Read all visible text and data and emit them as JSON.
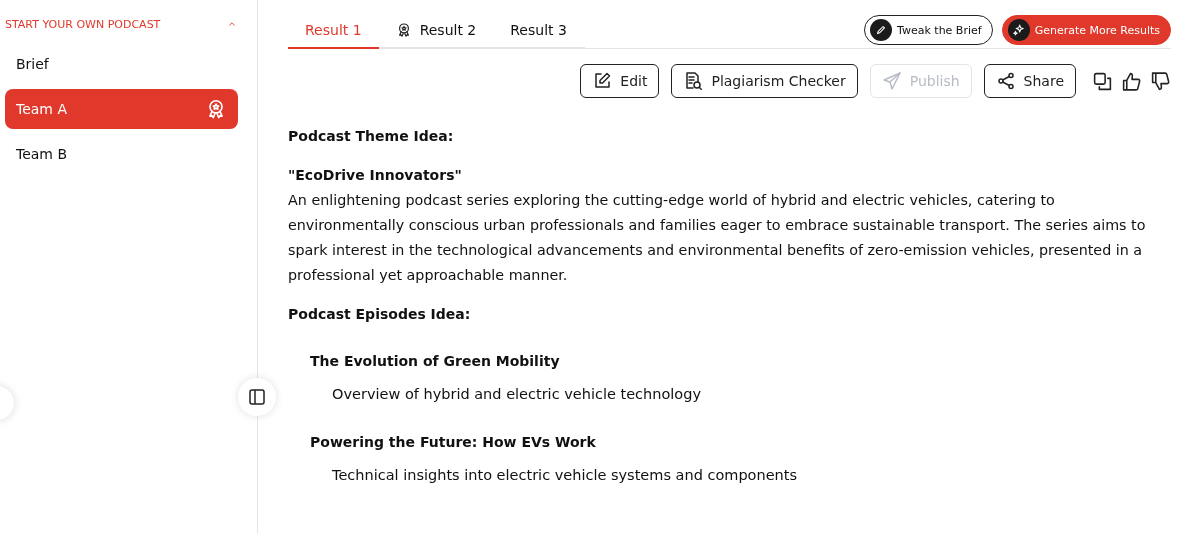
{
  "sidebar": {
    "section": {
      "title": "START YOUR OWN PODCAST",
      "expanded": true
    },
    "items": [
      {
        "label": "Brief",
        "selected": false,
        "award": false
      },
      {
        "label": "Team A",
        "selected": true,
        "award": true
      },
      {
        "label": "Team B",
        "selected": false,
        "award": false
      }
    ]
  },
  "tabs": [
    {
      "label": "Result 1",
      "selected": true,
      "award": false
    },
    {
      "label": "Result 2",
      "selected": false,
      "award": true
    },
    {
      "label": "Result 3",
      "selected": false,
      "award": false
    }
  ],
  "top_buttons": [
    {
      "label": "Tweak the Brief",
      "kind": "outline"
    },
    {
      "label": "Generate More Results",
      "kind": "primary"
    }
  ],
  "actions": [
    {
      "label": "Edit",
      "kind": "edit",
      "disabled": false
    },
    {
      "label": "Plagiarism Checker",
      "kind": "check",
      "disabled": false
    },
    {
      "label": "Publish",
      "kind": "send",
      "disabled": true
    },
    {
      "label": "Share",
      "kind": "share",
      "disabled": false
    }
  ],
  "content": [
    {
      "kind": "heading",
      "text": "Podcast Theme Idea:"
    },
    {
      "kind": "title",
      "text": "\"EcoDrive Innovators\""
    },
    {
      "kind": "paragraph",
      "text": "An enlightening podcast series exploring the cutting-edge world of hybrid and electric vehicles, catering to environmentally conscious urban professionals and families eager to embrace sustainable transport. The series aims to spark interest in the technological advancements and environmental benefits of zero-emission vehicles, presented in a professional yet approachable manner."
    },
    {
      "kind": "heading",
      "text": "Podcast Episodes Idea:"
    },
    {
      "kind": "episode",
      "text": "The Evolution of Green Mobility"
    },
    {
      "kind": "detail",
      "text": "Overview of hybrid and electric vehicle technology"
    },
    {
      "kind": "episode",
      "text": "Powering the Future: How EVs Work"
    },
    {
      "kind": "detail",
      "text": "Technical insights into electric vehicle systems and components"
    }
  ]
}
